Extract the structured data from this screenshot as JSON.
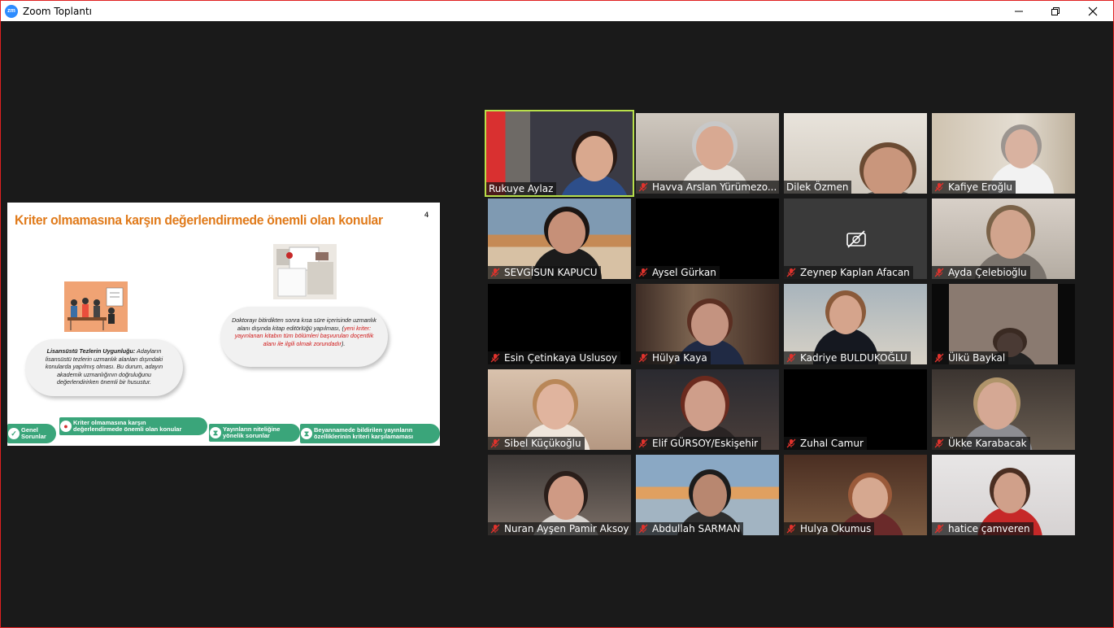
{
  "window": {
    "app_icon_text": "zm",
    "title": "Zoom Toplantı",
    "icon_names": [
      "minimize-icon",
      "restore-icon",
      "close-icon"
    ]
  },
  "slide": {
    "title": "Kriter olmamasına karşın değerlendirmede önemli olan konular",
    "number": "4",
    "bubble_left": {
      "heading": "Lisansüstü Tezlerin Uygunluğu:",
      "text": " Adayların lisansüstü tezlerin uzmanlık alanları dışındaki konularda yapılmış olması. Bu durum, adayın akademik uzmanlığının doğruluğunu değerlendirirken önemli bir husustur."
    },
    "bubble_right": {
      "text": "Doktorayı bitirdikten sonra kısa süre içerisinde uzmanlık alanı  dışında kitap editörlüğü yapılması, (",
      "red_text": "yeni kriter: yayınlanan kitabın tüm bölümleri başvurulan doçentlik alanı ile ilgili olmak zorundadır",
      "tail": ")."
    },
    "nav": [
      {
        "line1": "Genel",
        "line2": "Sorunlar",
        "icon": "check-icon"
      },
      {
        "line1": "Kriter olmamasına karşın",
        "line2": "değerlendirmede önemli olan konular",
        "icon": "location-pin-icon"
      },
      {
        "line1": "Yayınların niteliğine",
        "line2": "yönelik sorunlar",
        "icon": "hourglass-icon"
      },
      {
        "line1": "Beyannamede bildirilen yayınların",
        "line2": "özelliklerinin kriteri karşılamaması",
        "icon": "hourglass-icon"
      }
    ]
  },
  "participants": [
    {
      "name": "Rukuye Aylaz",
      "muted": false,
      "active": true,
      "video": true
    },
    {
      "name": "Havva Arslan Yürümezo...",
      "muted": true,
      "active": false,
      "video": true
    },
    {
      "name": "Dilek Özmen",
      "muted": false,
      "active": false,
      "video": true
    },
    {
      "name": "Kafiye Eroğlu",
      "muted": true,
      "active": false,
      "video": true
    },
    {
      "name": "SEVGİSUN KAPUCU",
      "muted": true,
      "active": false,
      "video": true
    },
    {
      "name": "Aysel Gürkan",
      "muted": true,
      "active": false,
      "video": false
    },
    {
      "name": "Zeynep Kaplan Afacan",
      "muted": true,
      "active": false,
      "video": false,
      "camera_off_icon": "camera-off-icon"
    },
    {
      "name": "Ayda Çelebioğlu",
      "muted": true,
      "active": false,
      "video": true
    },
    {
      "name": "Esin Çetinkaya Uslusoy",
      "muted": true,
      "active": false,
      "video": false
    },
    {
      "name": "Hülya Kaya",
      "muted": true,
      "active": false,
      "video": true
    },
    {
      "name": "Kadriye BULDUKOĞLU",
      "muted": true,
      "active": false,
      "video": true
    },
    {
      "name": "Ülkü Baykal",
      "muted": true,
      "active": false,
      "video": true
    },
    {
      "name": "Sibel Küçükoğlu",
      "muted": true,
      "active": false,
      "video": true
    },
    {
      "name": "Elif GÜRSOY/Eskişehir",
      "muted": true,
      "active": false,
      "video": true
    },
    {
      "name": "Zuhal Camur",
      "muted": true,
      "active": false,
      "video": false
    },
    {
      "name": "Ükke Karabacak",
      "muted": true,
      "active": false,
      "video": true
    },
    {
      "name": "Nuran Ayşen Pamir Aksoy",
      "muted": true,
      "active": false,
      "video": true
    },
    {
      "name": "Abdullah SARMAN",
      "muted": true,
      "active": false,
      "video": true
    },
    {
      "name": "Hulya Okumus",
      "muted": true,
      "active": false,
      "video": true
    },
    {
      "name": "hatice çamveren",
      "muted": true,
      "active": false,
      "video": true
    }
  ],
  "colors": {
    "active_speaker_border": "#b8e04a",
    "muted_icon": "#e0322c",
    "slide_title": "#e07a1a",
    "slide_nav": "#3aa57a",
    "window_border": "#e02020"
  }
}
